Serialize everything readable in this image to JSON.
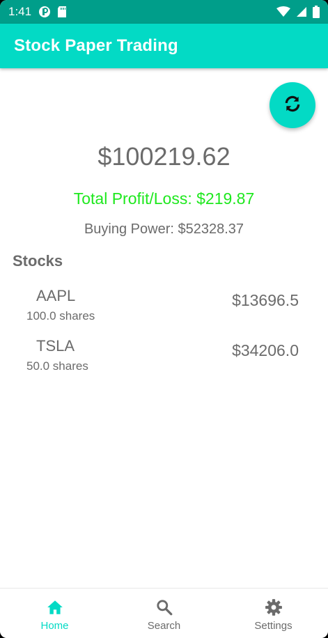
{
  "status_bar": {
    "time": "1:41",
    "icons": [
      "notification-app-icon",
      "sd-card-icon",
      "wifi-icon",
      "signal-icon",
      "battery-icon"
    ]
  },
  "app_bar": {
    "title": "Stock Paper Trading"
  },
  "fab": {
    "icon": "refresh-icon"
  },
  "portfolio": {
    "value": "$100219.62",
    "profit_loss": "Total Profit/Loss: $219.87",
    "buying_power": "Buying Power: $52328.37"
  },
  "stocks": {
    "heading": "Stocks",
    "items": [
      {
        "symbol": "AAPL",
        "shares": "100.0 shares",
        "value": "$13696.5"
      },
      {
        "symbol": "TSLA",
        "shares": "50.0 shares",
        "value": "$34206.0"
      }
    ]
  },
  "bottom_nav": {
    "items": [
      {
        "label": "Home",
        "icon": "home-icon",
        "active": true
      },
      {
        "label": "Search",
        "icon": "search-icon",
        "active": false
      },
      {
        "label": "Settings",
        "icon": "gear-icon",
        "active": false
      }
    ]
  },
  "colors": {
    "status_bar": "#009e8a",
    "accent": "#03dac5",
    "profit": "#1ee81e",
    "text": "#6b6b6b"
  }
}
